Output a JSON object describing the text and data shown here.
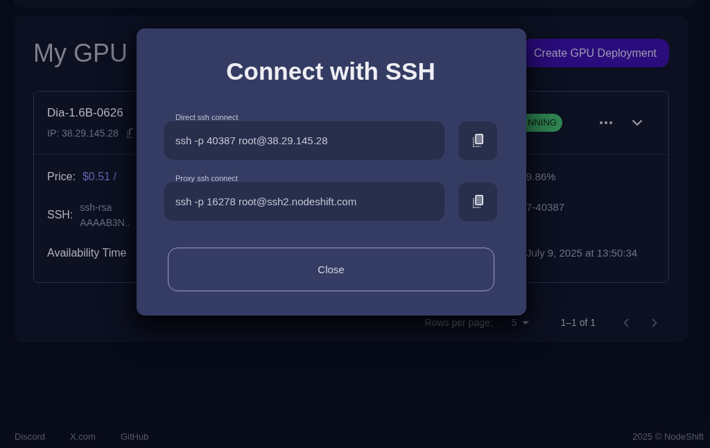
{
  "page": {
    "title": "My GPU",
    "create_button": "Create GPU Deployment"
  },
  "deployment": {
    "name": "Dia-1.6B-0626",
    "ip": "IP: 38.29.145.28",
    "status": "NNING",
    "price": {
      "label": "Price:",
      "value": "$0.51 /"
    },
    "ssh": {
      "label": "SSH:",
      "lines": [
        "ssh-rsa",
        "AAAAB3N.."
      ]
    },
    "availability": {
      "label": "Availability Time"
    },
    "right_column": [
      "9.86%",
      "7-40387",
      "July 9, 2025 at 13:50:34"
    ]
  },
  "pagination": {
    "rows_label": "Rows per page:",
    "rows_value": "5",
    "range": "1–1 of 1"
  },
  "modal": {
    "title": "Connect with SSH",
    "fields": [
      {
        "label": "Direct ssh connect",
        "value": "ssh -p 40387 root@38.29.145.28"
      },
      {
        "label": "Proxy ssh connect",
        "value": "ssh -p 16278 root@ssh2.nodeshift.com"
      }
    ],
    "close_button": "Close"
  },
  "footer": {
    "links": [
      "Discord",
      "X.com",
      "GitHub"
    ],
    "copyright": "2025 © NodeShift"
  }
}
